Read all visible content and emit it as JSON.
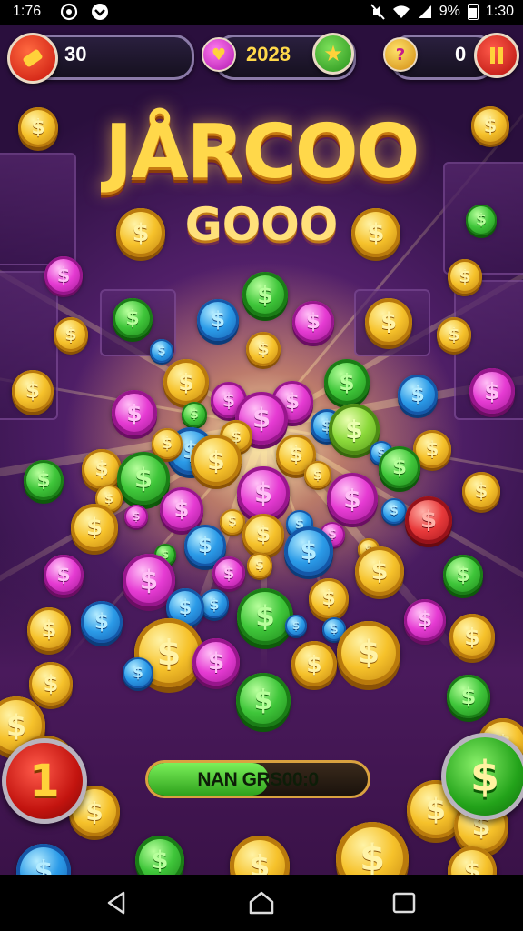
{
  "status_bar": {
    "time": "1:76",
    "battery": "9%",
    "clock_right": "1:30",
    "icons": [
      "whatsapp-icon",
      "notification-icon",
      "mute-icon",
      "wifi-icon",
      "signal-icon",
      "battery-icon"
    ]
  },
  "hud": {
    "left_counter": "30",
    "center_counter": "2028",
    "right_counter": "0",
    "left_icon": "ticket-icon",
    "center_icon": "gem-icon",
    "center_action_icon": "star-icon",
    "right_icon": "gold-gem-icon",
    "pause_icon": "pause-icon"
  },
  "title": {
    "main": "JÅRCOO",
    "sub": "GOOO"
  },
  "bottom": {
    "bet_button": "1",
    "progress_label": "NAN GRS00:0",
    "progress_fraction": 0.55,
    "cash_button": "$"
  },
  "colors": {
    "gold": "#f6c22b",
    "green": "#3fc63a",
    "blue": "#2b9be8",
    "pink": "#e63bd3",
    "red": "#e8393a",
    "lime": "#8bd93a"
  },
  "nav": {
    "back_icon": "back-icon",
    "home_icon": "home-icon",
    "recents_icon": "recents-icon"
  }
}
